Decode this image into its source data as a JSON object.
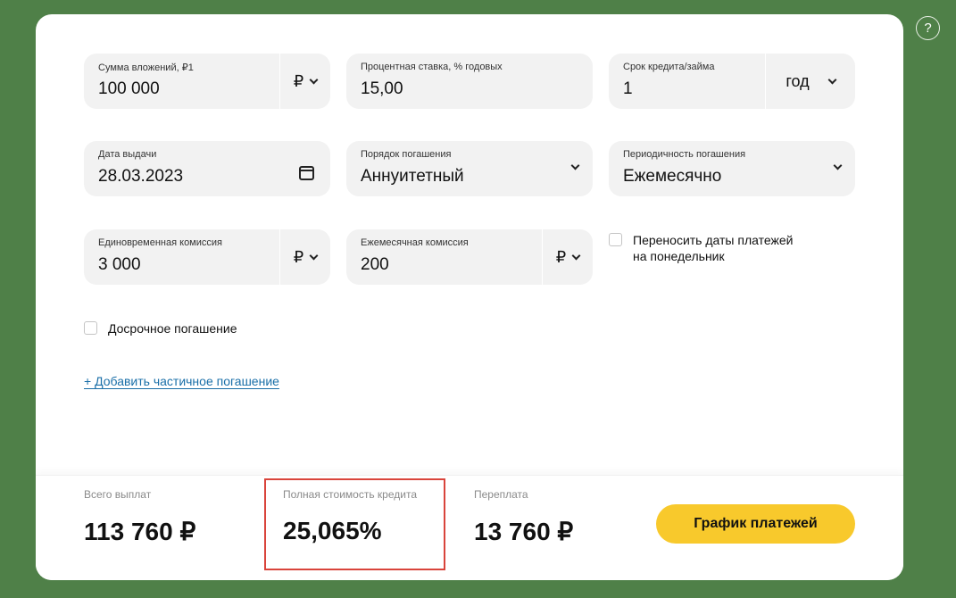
{
  "help": {
    "label": "?"
  },
  "form": {
    "amount": {
      "label": "Сумма вложений, ₽1",
      "value": "100 000",
      "unit": "₽"
    },
    "rate": {
      "label": "Процентная ставка, % годовых",
      "value": "15,00"
    },
    "term": {
      "label": "Срок кредита/займа",
      "value": "1",
      "unit": "год"
    },
    "issue_date": {
      "label": "Дата выдачи",
      "value": "28.03.2023"
    },
    "repayment_order": {
      "label": "Порядок погашения",
      "value": "Аннуитетный"
    },
    "repayment_frequency": {
      "label": "Периодичность погашения",
      "value": "Ежемесячно"
    },
    "one_time_fee": {
      "label": "Единовременная комиссия",
      "value": "3 000",
      "unit": "₽"
    },
    "monthly_fee": {
      "label": "Ежемесячная комиссия",
      "value": "200",
      "unit": "₽"
    },
    "move_to_monday": {
      "label_line1": "Переносить даты платежей",
      "label_line2": "на понедельник",
      "checked": false
    },
    "early_repayment": {
      "label": "Досрочное погашение",
      "checked": false
    },
    "add_partial_link": "+ Добавить частичное погашение"
  },
  "summary": {
    "total": {
      "label": "Всего выплат",
      "value": "113 760 ₽"
    },
    "full_cost": {
      "label": "Полная стоимость кредита",
      "value": "25,065%"
    },
    "overpayment": {
      "label": "Переплата",
      "value": "13 760 ₽"
    },
    "schedule_button": "График платежей"
  },
  "colors": {
    "background": "#4f8048",
    "accent": "#f8c92c",
    "highlight": "#d9443b",
    "link": "#1a6fa8"
  }
}
